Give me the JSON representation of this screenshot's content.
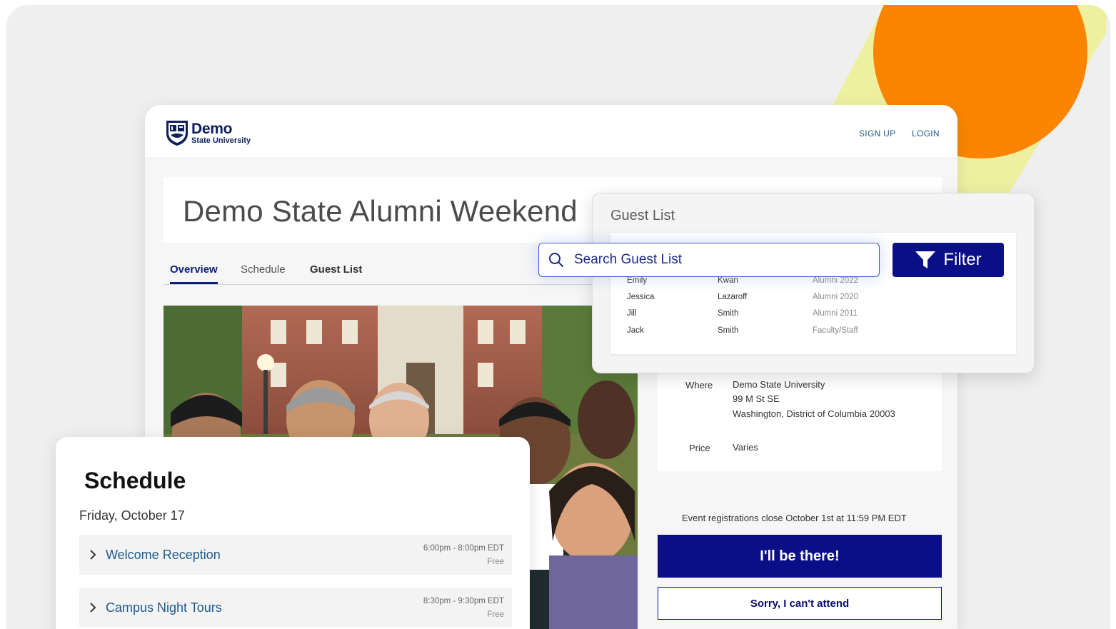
{
  "header": {
    "logo_word": "Demo",
    "logo_sub": "State University",
    "signup_label": "SIGN UP",
    "login_label": "LOGIN"
  },
  "event": {
    "title": "Demo State Alumni Weekend"
  },
  "tabs": [
    {
      "label": "Overview",
      "active": true
    },
    {
      "label": "Schedule",
      "active": false
    },
    {
      "label": "Guest List",
      "active": false
    }
  ],
  "details": {
    "where_label": "Where",
    "where_name": "Demo State University",
    "where_street": "99 M St SE",
    "where_city": "Washington, District of Columbia 20003",
    "price_label": "Price",
    "price_value": "Varies"
  },
  "registration": {
    "note": "Event registrations close October 1st at 11:59 PM EDT",
    "rsvp_label": "I'll be there!",
    "decline_label": "Sorry, I can't attend"
  },
  "guest_list": {
    "title": "Guest List",
    "search_placeholder": "Search Guest List",
    "filter_label": "Filter",
    "rows": [
      {
        "first": "Emily",
        "last": "Kwan",
        "group": "Alumni 2022"
      },
      {
        "first": "Jessica",
        "last": "Lazaroff",
        "group": "Alumni 2020"
      },
      {
        "first": "Jill",
        "last": "Smith",
        "group": "Alumni 2011"
      },
      {
        "first": "Jack",
        "last": "Smith",
        "group": "Faculty/Staff"
      }
    ]
  },
  "schedule": {
    "title": "Schedule",
    "date": "Friday, October 17",
    "items": [
      {
        "name": "Welcome Reception",
        "time": "6:00pm - 8:00pm EDT",
        "price": "Free"
      },
      {
        "name": "Campus Night Tours",
        "time": "8:30pm - 9:30pm EDT",
        "price": "Free"
      }
    ]
  },
  "colors": {
    "accent": "#0a0f87",
    "link": "#1c5a8f",
    "orange": "#fb8500",
    "yellow": "#eef0a0"
  },
  "icons": [
    "shield-crest-icon",
    "search-icon",
    "filter-funnel-icon",
    "chevron-right-icon"
  ]
}
